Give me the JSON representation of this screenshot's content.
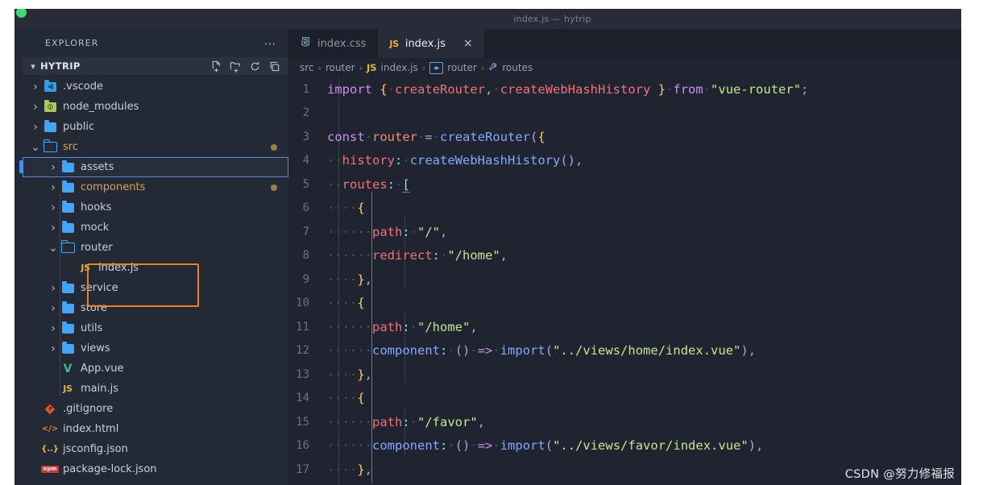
{
  "titlebar": {
    "title": "index.js — hytrip"
  },
  "sidebar": {
    "header": {
      "label": "EXPLORER",
      "more_icon": "ellipsis-icon"
    },
    "project": {
      "name": "HYTRIP",
      "expanded": true,
      "actions": [
        {
          "name": "new-file-icon",
          "tooltip": "New File"
        },
        {
          "name": "new-folder-icon",
          "tooltip": "New Folder"
        },
        {
          "name": "refresh-icon",
          "tooltip": "Refresh Explorer"
        },
        {
          "name": "collapse-all-icon",
          "tooltip": "Collapse Folders in Explorer"
        }
      ]
    },
    "tree": [
      {
        "label": ".vscode",
        "type": "folder",
        "icon": "folder-vscode-icon",
        "depth": 0,
        "twisty": "collapsed",
        "modified": false,
        "dot": false,
        "selected": false
      },
      {
        "label": "node_modules",
        "type": "folder",
        "icon": "folder-npm-icon",
        "depth": 0,
        "twisty": "collapsed",
        "modified": false,
        "dot": false,
        "selected": false
      },
      {
        "label": "public",
        "type": "folder",
        "icon": "folder-icon",
        "depth": 0,
        "twisty": "collapsed",
        "modified": false,
        "dot": false,
        "selected": false
      },
      {
        "label": "src",
        "type": "folder",
        "icon": "folder-open-icon",
        "depth": 0,
        "twisty": "expanded",
        "modified": true,
        "dot": true,
        "selected": false
      },
      {
        "label": "assets",
        "type": "folder",
        "icon": "folder-icon",
        "depth": 1,
        "twisty": "collapsed",
        "modified": false,
        "dot": false,
        "selected": true
      },
      {
        "label": "components",
        "type": "folder",
        "icon": "folder-icon",
        "depth": 1,
        "twisty": "collapsed",
        "modified": true,
        "dot": true,
        "selected": false
      },
      {
        "label": "hooks",
        "type": "folder",
        "icon": "folder-icon",
        "depth": 1,
        "twisty": "collapsed",
        "modified": false,
        "dot": false,
        "selected": false
      },
      {
        "label": "mock",
        "type": "folder",
        "icon": "folder-icon",
        "depth": 1,
        "twisty": "collapsed",
        "modified": false,
        "dot": false,
        "selected": false
      },
      {
        "label": "router",
        "type": "folder",
        "icon": "folder-open-icon",
        "depth": 1,
        "twisty": "expanded",
        "modified": false,
        "dot": false,
        "selected": false
      },
      {
        "label": "index.js",
        "type": "file",
        "icon": "js-file-icon",
        "depth": 2,
        "twisty": "none",
        "modified": false,
        "dot": false,
        "selected": false
      },
      {
        "label": "service",
        "type": "folder",
        "icon": "folder-icon",
        "depth": 1,
        "twisty": "collapsed",
        "modified": false,
        "dot": false,
        "selected": false
      },
      {
        "label": "store",
        "type": "folder",
        "icon": "folder-icon",
        "depth": 1,
        "twisty": "collapsed",
        "modified": false,
        "dot": false,
        "selected": false
      },
      {
        "label": "utils",
        "type": "folder",
        "icon": "folder-icon",
        "depth": 1,
        "twisty": "collapsed",
        "modified": false,
        "dot": false,
        "selected": false
      },
      {
        "label": "views",
        "type": "folder",
        "icon": "folder-icon",
        "depth": 1,
        "twisty": "collapsed",
        "modified": false,
        "dot": false,
        "selected": false
      },
      {
        "label": "App.vue",
        "type": "file",
        "icon": "vue-file-icon",
        "depth": 1,
        "twisty": "none",
        "modified": false,
        "dot": false,
        "selected": false
      },
      {
        "label": "main.js",
        "type": "file",
        "icon": "js-file-icon",
        "depth": 1,
        "twisty": "none",
        "modified": false,
        "dot": false,
        "selected": false
      },
      {
        "label": ".gitignore",
        "type": "file",
        "icon": "git-file-icon",
        "depth": 0,
        "twisty": "none",
        "modified": false,
        "dot": false,
        "selected": false
      },
      {
        "label": "index.html",
        "type": "file",
        "icon": "html-file-icon",
        "depth": 0,
        "twisty": "none",
        "modified": false,
        "dot": false,
        "selected": false
      },
      {
        "label": "jsconfig.json",
        "type": "file",
        "icon": "json-file-icon",
        "depth": 0,
        "twisty": "none",
        "modified": false,
        "dot": false,
        "selected": false
      },
      {
        "label": "package-lock.json",
        "type": "file",
        "icon": "npm-file-icon",
        "depth": 0,
        "twisty": "none",
        "modified": false,
        "dot": false,
        "selected": false
      }
    ]
  },
  "editor": {
    "tabs": [
      {
        "label": "index.css",
        "icon": "css-file-icon",
        "active": false,
        "closable": false
      },
      {
        "label": "index.js",
        "icon": "js-file-icon",
        "active": true,
        "closable": true,
        "close_glyph": "×"
      }
    ],
    "breadcrumb": [
      {
        "label": "src",
        "icon": "none"
      },
      {
        "label": "router",
        "icon": "none"
      },
      {
        "label": "index.js",
        "icon": "js-file-icon"
      },
      {
        "label": "router",
        "icon": "symbol-variable-icon"
      },
      {
        "label": "routes",
        "icon": "symbol-property-icon"
      }
    ],
    "breadcrumb_separator": "›",
    "lines": [
      {
        "num": "1",
        "tokens": [
          {
            "t": "import",
            "c": "kw"
          },
          {
            "t": " ",
            "c": "ws"
          },
          {
            "t": "{",
            "c": "brace"
          },
          {
            "t": "·",
            "c": "ws"
          },
          {
            "t": "createRouter",
            "c": "ident"
          },
          {
            "t": ",",
            "c": "plain"
          },
          {
            "t": "·",
            "c": "ws"
          },
          {
            "t": "createWebHashHistory",
            "c": "ident"
          },
          {
            "t": " ",
            "c": "ws"
          },
          {
            "t": "}",
            "c": "brace"
          },
          {
            "t": "·",
            "c": "ws"
          },
          {
            "t": "from",
            "c": "kw"
          },
          {
            "t": "·",
            "c": "ws"
          },
          {
            "t": "\"vue-router\"",
            "c": "str"
          },
          {
            "t": ";",
            "c": "plain"
          }
        ]
      },
      {
        "num": "2",
        "tokens": []
      },
      {
        "num": "3",
        "tokens": [
          {
            "t": "const",
            "c": "kw"
          },
          {
            "t": "·",
            "c": "ws"
          },
          {
            "t": "router",
            "c": "var"
          },
          {
            "t": "·",
            "c": "ws"
          },
          {
            "t": "=",
            "c": "plain"
          },
          {
            "t": "·",
            "c": "ws"
          },
          {
            "t": "createRouter",
            "c": "fn"
          },
          {
            "t": "(",
            "c": "paren"
          },
          {
            "t": "{",
            "c": "brace"
          }
        ]
      },
      {
        "num": "4",
        "tokens": [
          {
            "t": "··",
            "c": "ws"
          },
          {
            "t": "history",
            "c": "prop"
          },
          {
            "t": ":",
            "c": "punct"
          },
          {
            "t": "·",
            "c": "ws"
          },
          {
            "t": "createWebHashHistory",
            "c": "fn"
          },
          {
            "t": "()",
            "c": "paren"
          },
          {
            "t": ",",
            "c": "plain"
          }
        ]
      },
      {
        "num": "5",
        "tokens": [
          {
            "t": "··",
            "c": "ws"
          },
          {
            "t": "routes",
            "c": "prop"
          },
          {
            "t": ":",
            "c": "punct"
          },
          {
            "t": "·",
            "c": "ws"
          },
          {
            "t": "[",
            "c": "punct",
            "underline": true
          }
        ]
      },
      {
        "num": "6",
        "tokens": [
          {
            "t": "····",
            "c": "ws"
          },
          {
            "t": "{",
            "c": "brace"
          }
        ]
      },
      {
        "num": "7",
        "tokens": [
          {
            "t": "······",
            "c": "ws"
          },
          {
            "t": "path",
            "c": "prop"
          },
          {
            "t": ":",
            "c": "punct"
          },
          {
            "t": "·",
            "c": "ws"
          },
          {
            "t": "\"/\"",
            "c": "str"
          },
          {
            "t": ",",
            "c": "plain"
          }
        ]
      },
      {
        "num": "8",
        "tokens": [
          {
            "t": "······",
            "c": "ws"
          },
          {
            "t": "redirect",
            "c": "prop"
          },
          {
            "t": ":",
            "c": "punct"
          },
          {
            "t": "·",
            "c": "ws"
          },
          {
            "t": "\"/home\"",
            "c": "str"
          },
          {
            "t": ",",
            "c": "plain"
          }
        ]
      },
      {
        "num": "9",
        "tokens": [
          {
            "t": "····",
            "c": "ws"
          },
          {
            "t": "}",
            "c": "brace"
          },
          {
            "t": ",",
            "c": "plain"
          }
        ]
      },
      {
        "num": "10",
        "tokens": [
          {
            "t": "····",
            "c": "ws"
          },
          {
            "t": "{",
            "c": "brace"
          }
        ]
      },
      {
        "num": "11",
        "tokens": [
          {
            "t": "······",
            "c": "ws"
          },
          {
            "t": "path",
            "c": "prop"
          },
          {
            "t": ":",
            "c": "punct"
          },
          {
            "t": "·",
            "c": "ws"
          },
          {
            "t": "\"/home\"",
            "c": "str"
          },
          {
            "t": ",",
            "c": "plain"
          }
        ]
      },
      {
        "num": "12",
        "tokens": [
          {
            "t": "······",
            "c": "ws"
          },
          {
            "t": "component",
            "c": "fn"
          },
          {
            "t": ":",
            "c": "punct"
          },
          {
            "t": "·",
            "c": "ws"
          },
          {
            "t": "()",
            "c": "paren"
          },
          {
            "t": "·",
            "c": "ws"
          },
          {
            "t": "=>",
            "c": "arrow"
          },
          {
            "t": "·",
            "c": "ws"
          },
          {
            "t": "import",
            "c": "fn"
          },
          {
            "t": "(",
            "c": "plain"
          },
          {
            "t": "\"../views/home/index.vue\"",
            "c": "str"
          },
          {
            "t": ")",
            "c": "plain"
          },
          {
            "t": ",",
            "c": "plain"
          }
        ]
      },
      {
        "num": "13",
        "tokens": [
          {
            "t": "····",
            "c": "ws"
          },
          {
            "t": "}",
            "c": "brace"
          },
          {
            "t": ",",
            "c": "plain"
          }
        ]
      },
      {
        "num": "14",
        "tokens": [
          {
            "t": "····",
            "c": "ws"
          },
          {
            "t": "{",
            "c": "brace"
          }
        ]
      },
      {
        "num": "15",
        "tokens": [
          {
            "t": "······",
            "c": "ws"
          },
          {
            "t": "path",
            "c": "prop"
          },
          {
            "t": ":",
            "c": "punct"
          },
          {
            "t": "·",
            "c": "ws"
          },
          {
            "t": "\"/favor\"",
            "c": "str"
          },
          {
            "t": ",",
            "c": "plain"
          }
        ]
      },
      {
        "num": "16",
        "tokens": [
          {
            "t": "······",
            "c": "ws"
          },
          {
            "t": "component",
            "c": "fn"
          },
          {
            "t": ":",
            "c": "punct"
          },
          {
            "t": "·",
            "c": "ws"
          },
          {
            "t": "()",
            "c": "paren"
          },
          {
            "t": "·",
            "c": "ws"
          },
          {
            "t": "=>",
            "c": "arrow"
          },
          {
            "t": "·",
            "c": "ws"
          },
          {
            "t": "import",
            "c": "fn"
          },
          {
            "t": "(",
            "c": "plain"
          },
          {
            "t": "\"../views/favor/index.vue\"",
            "c": "str"
          },
          {
            "t": ")",
            "c": "plain"
          },
          {
            "t": ",",
            "c": "plain"
          }
        ]
      },
      {
        "num": "17",
        "tokens": [
          {
            "t": "····",
            "c": "ws"
          },
          {
            "t": "}",
            "c": "brace"
          },
          {
            "t": ",",
            "c": "plain"
          }
        ]
      }
    ]
  },
  "watermark": {
    "text": "CSDN @努力修福报"
  },
  "colors": {
    "accent_blue": "#4a90e2",
    "highlight_orange": "#e8811e",
    "editor_bg": "#1f2430",
    "sidebar_bg": "#242936",
    "modified_file": "#d4a05a"
  }
}
